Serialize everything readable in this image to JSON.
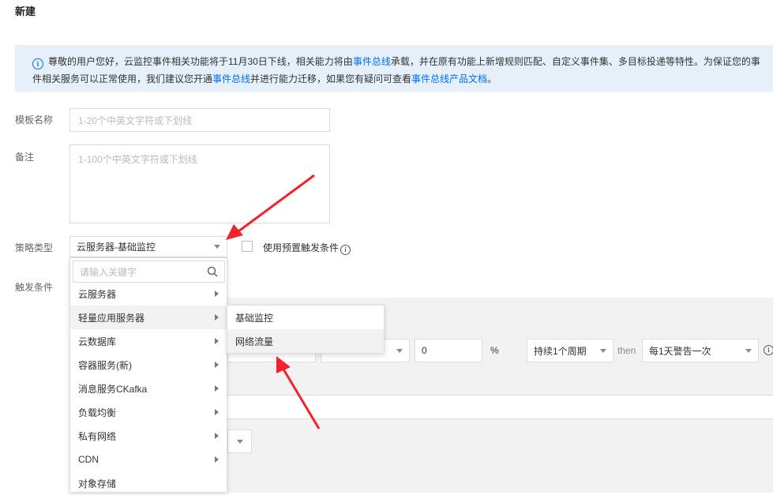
{
  "page": {
    "title": "新建"
  },
  "notice": {
    "text1": "尊敬的用户您好，云监控事件相关功能将于11月30日下线，相关能力将由",
    "link1": "事件总线",
    "text2": "承载，并在原有功能上新增规则匹配、自定义事件集、多目标投递等特性。为保证您的事件相关服务可以正常使用，我们建议您开通",
    "link2": "事件总线",
    "text3": "并进行能力迁移，如果您有疑问可查看",
    "link3": "事件总线产品文档",
    "text4": "。"
  },
  "form": {
    "template_name": {
      "label": "模板名称",
      "placeholder": "1-20个中英文字符或下划线"
    },
    "remark": {
      "label": "备注",
      "placeholder": "1-100个中英文字符或下划线"
    },
    "policy_type": {
      "label": "策略类型",
      "value": "云服务器-基础监控"
    },
    "preset_checkbox_label": "使用预置触发条件",
    "trigger_label": "触发条件"
  },
  "dropdown": {
    "search_placeholder": "请输入关键字",
    "items": [
      {
        "label": "云服务器",
        "has_sub": true
      },
      {
        "label": "轻量应用服务器",
        "has_sub": true
      },
      {
        "label": "云数据库",
        "has_sub": true
      },
      {
        "label": "容器服务(新)",
        "has_sub": true
      },
      {
        "label": "消息服务CKafka",
        "has_sub": true
      },
      {
        "label": "负载均衡",
        "has_sub": true
      },
      {
        "label": "私有网络",
        "has_sub": true
      },
      {
        "label": "CDN",
        "has_sub": true
      },
      {
        "label": "对象存储",
        "has_sub": false
      }
    ]
  },
  "submenu": {
    "items": [
      {
        "label": "基础监控"
      },
      {
        "label": "网络流量"
      }
    ]
  },
  "trigger_row": {
    "value": "0",
    "unit": "%",
    "period": "持续1个周期",
    "then": "then",
    "alarm": "每1天警告一次"
  },
  "colors": {
    "accent": "#006eff",
    "annotation_red": "#f5222d",
    "notice_bg": "#e5f0fb"
  }
}
